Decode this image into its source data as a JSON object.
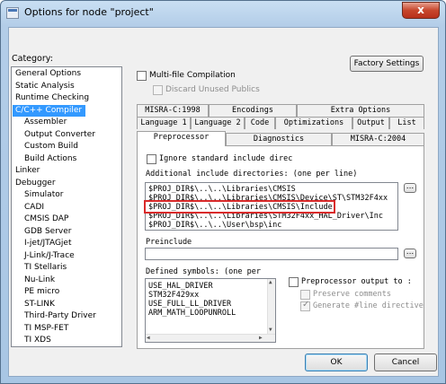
{
  "window": {
    "title": "Options for node \"project\"",
    "close_glyph": "x"
  },
  "category": {
    "label": "Category:",
    "items": [
      "General Options",
      "Static Analysis",
      "Runtime Checking",
      "C/C++ Compiler",
      "Assembler",
      "Output Converter",
      "Custom Build",
      "Build Actions",
      "Linker",
      "Debugger",
      "Simulator",
      "CADI",
      "CMSIS DAP",
      "GDB Server",
      "I-jet/JTAGjet",
      "J-Link/J-Trace",
      "TI Stellaris",
      "Nu-Link",
      "PE micro",
      "ST-LINK",
      "Third-Party Driver",
      "TI MSP-FET",
      "TI XDS"
    ],
    "selected_index": 3
  },
  "top": {
    "factory_settings": "Factory Settings",
    "multifile": "Multi-file Compilation",
    "discard": "Discard Unused Publics"
  },
  "tabs": {
    "row1": [
      "MISRA-C:1998",
      "Encodings",
      "Extra Options"
    ],
    "row2": [
      "Language 1",
      "Language 2",
      "Code",
      "Optimizations",
      "Output",
      "List"
    ],
    "row3": [
      "Preprocessor",
      "Diagnostics",
      "MISRA-C:2004"
    ],
    "active": "Preprocessor"
  },
  "preprocessor": {
    "ignore_std": "Ignore standard include direc",
    "additional_label": "Additional include directories: (one per line)",
    "include_dirs": [
      "$PROJ_DIR$\\..\\..\\Libraries\\CMSIS",
      "$PROJ_DIR$\\..\\..\\Libraries\\CMSIS\\Device\\ST\\STM32F4xx",
      "$PROJ_DIR$\\..\\..\\Libraries\\CMSIS\\Include",
      "$PROJ_DIR$\\..\\..\\Libraries\\STM32F4xx_HAL_Driver\\Inc",
      "$PROJ_DIR$\\..\\..\\User\\bsp\\inc"
    ],
    "browse": "...",
    "preinclude_label": "Preinclude",
    "defined_label": "Defined symbols: (one per",
    "defined_symbols": [
      "USE_HAL_DRIVER",
      "STM32F429xx",
      "USE_FULL_LL_DRIVER",
      "ARM_MATH_LOOPUNROLL"
    ],
    "pp_output": "Preprocessor output to :",
    "preserve": "Preserve comments",
    "generate_line": "Generate #line directive"
  },
  "buttons": {
    "ok": "OK",
    "cancel": "Cancel"
  },
  "colors": {
    "selection": "#3399ff",
    "highlight_box": "#d92a2a"
  }
}
